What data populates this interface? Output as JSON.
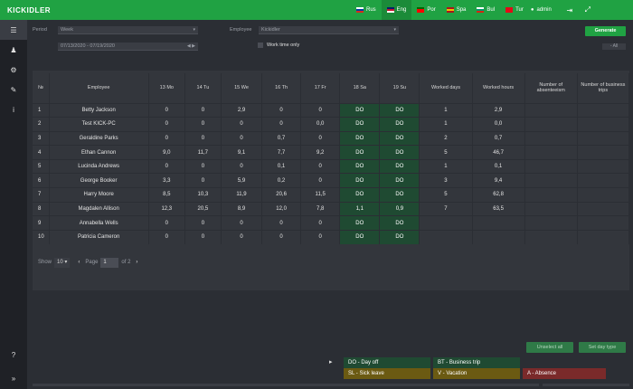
{
  "app": {
    "logo": "KICKIDLER"
  },
  "topbar": {
    "languages": [
      {
        "label": "Rus",
        "active": false,
        "flag": [
          "#ffffff",
          "#0039a6",
          "#d52b1e"
        ]
      },
      {
        "label": "Eng",
        "active": true,
        "flag": [
          "#012169",
          "#c8102e",
          "#ffffff"
        ]
      },
      {
        "label": "Por",
        "active": false,
        "flag": [
          "#006600",
          "#ff0000",
          "#ff0000"
        ]
      },
      {
        "label": "Spa",
        "active": false,
        "flag": [
          "#aa151b",
          "#f1bf00",
          "#aa151b"
        ]
      },
      {
        "label": "Bul",
        "active": false,
        "flag": [
          "#ffffff",
          "#00966e",
          "#d62612"
        ]
      },
      {
        "label": "Tur",
        "active": false,
        "flag": [
          "#e30a17",
          "#e30a17",
          "#e30a17"
        ]
      }
    ],
    "user": "admin",
    "user_icon": "user-icon",
    "logout_icon": "logout-icon",
    "fullscreen_icon": "fullscreen-icon"
  },
  "sidebar": {
    "items": [
      {
        "icon": "menu-icon",
        "glyph": "☰"
      },
      {
        "icon": "user-icon",
        "glyph": "♟"
      },
      {
        "icon": "settings-icon",
        "glyph": "⚙"
      },
      {
        "icon": "wrench-icon",
        "glyph": "✎"
      },
      {
        "icon": "info-icon",
        "glyph": "i"
      }
    ],
    "help_glyph": "?",
    "expand_glyph": "»"
  },
  "filters": {
    "period_label": "Period",
    "period_value": "Week",
    "date_range": "07/13/2020 - 07/19/2020",
    "date_nav": "◀ ▶",
    "employee_label": "Employee",
    "employee_value": "Kickidler",
    "work_time_only": "Work time only",
    "generate": "Generate",
    "all_button": "- All"
  },
  "table": {
    "headers": [
      "№",
      "Employee",
      "13 Mo",
      "14 Tu",
      "15 We",
      "16 Th",
      "17 Fr",
      "18 Sa",
      "19 Su",
      "Worked days",
      "Worked hours",
      "Number of absenteeism",
      "Number of business trips"
    ],
    "rows": [
      [
        "1",
        "Betty Jackson",
        "0",
        "0",
        "2,9",
        "0",
        "0",
        "DO",
        "DO",
        "1",
        "2,9",
        "",
        ""
      ],
      [
        "2",
        "Test KICK-PC",
        "0",
        "0",
        "0",
        "0",
        "0,0",
        "DO",
        "DO",
        "1",
        "0,0",
        "",
        ""
      ],
      [
        "3",
        "Geraldine Parks",
        "0",
        "0",
        "0",
        "0,7",
        "0",
        "DO",
        "DO",
        "2",
        "0,7",
        "",
        ""
      ],
      [
        "4",
        "Ethan Cannon",
        "9,0",
        "11,7",
        "9,1",
        "7,7",
        "9,2",
        "DO",
        "DO",
        "5",
        "46,7",
        "",
        ""
      ],
      [
        "5",
        "Lucinda Andrews",
        "0",
        "0",
        "0",
        "0,1",
        "0",
        "DO",
        "DO",
        "1",
        "0,1",
        "",
        ""
      ],
      [
        "6",
        "George Booker",
        "3,3",
        "0",
        "5,9",
        "0,2",
        "0",
        "DO",
        "DO",
        "3",
        "9,4",
        "",
        ""
      ],
      [
        "7",
        "Harry Moore",
        "8,5",
        "10,3",
        "11,9",
        "20,6",
        "11,5",
        "DO",
        "DO",
        "5",
        "62,8",
        "",
        ""
      ],
      [
        "8",
        "Magdalen Allison",
        "12,3",
        "20,5",
        "8,9",
        "12,0",
        "7,8",
        "1,1",
        "0,9",
        "7",
        "63,5",
        "",
        ""
      ],
      [
        "9",
        "Annabella Wells",
        "0",
        "0",
        "0",
        "0",
        "0",
        "DO",
        "DO",
        "",
        "",
        "",
        ""
      ],
      [
        "10",
        "Patricia Cameron",
        "0",
        "0",
        "0",
        "0",
        "0",
        "DO",
        "DO",
        "",
        "",
        "",
        ""
      ]
    ]
  },
  "pager": {
    "show_label": "Show",
    "page_size": "10",
    "page_label": "Page",
    "page_value": "1",
    "of_label": "of 2",
    "prev": "‹",
    "next": "›"
  },
  "actions": {
    "unselect_all": "Unselect all",
    "set_day_type": "Set day type"
  },
  "legend": {
    "arrow": "▸",
    "items": [
      {
        "label": "DO - Day off",
        "color": "#1f4a32"
      },
      {
        "label": "BT - Business trip",
        "color": "#1f4a32"
      },
      {
        "label": "SL - Sick leave",
        "color": "#6b5a12"
      },
      {
        "label": "V - Vacation",
        "color": "#6b5a12"
      },
      {
        "label": "A - Absence",
        "color": "#7a2a2a"
      }
    ]
  }
}
